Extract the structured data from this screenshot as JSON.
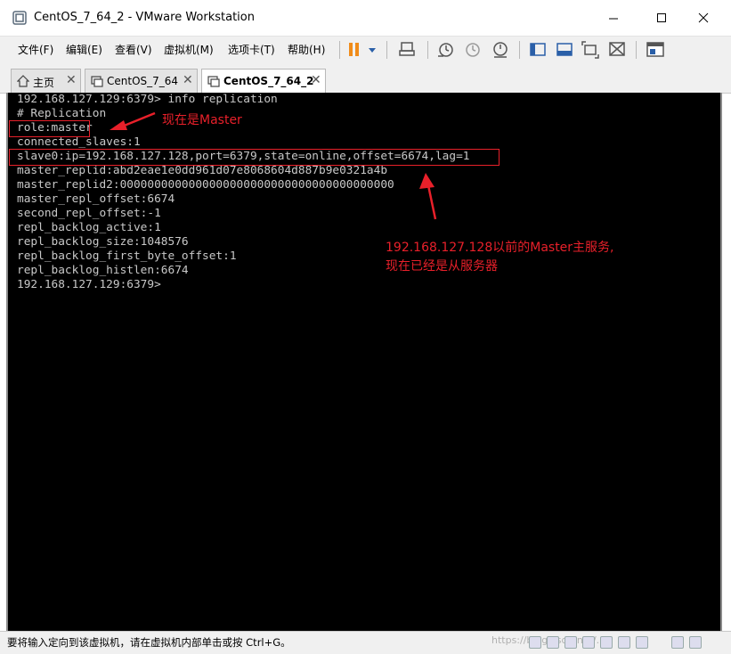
{
  "window": {
    "title": "CentOS_7_64_2 - VMware Workstation"
  },
  "menu": {
    "items": [
      "文件(F)",
      "编辑(E)",
      "查看(V)",
      "虚拟机(M)",
      "选项卡(T)",
      "帮助(H)"
    ]
  },
  "toolbar": {
    "icons": [
      "pause-icon",
      "dropdown-arrow-icon",
      "send-ctrl-alt-del-icon",
      "snapshot-take-icon",
      "snapshot-revert-icon",
      "snapshot-manager-icon",
      "view-sidebar-icon",
      "view-console-icon",
      "fullscreen-icon",
      "unity-icon",
      "library-icon"
    ]
  },
  "tabs": [
    {
      "label": "主页",
      "icon": "home-icon"
    },
    {
      "label": "CentOS_7_64",
      "icon": "vm-icon"
    },
    {
      "label": "CentOS_7_64_2",
      "icon": "vm-icon",
      "active": true
    }
  ],
  "console": {
    "lines": [
      "192.168.127.129:6379> info replication",
      "# Replication",
      "role:master",
      "connected_slaves:1",
      "slave0:ip=192.168.127.128,port=6379,state=online,offset=6674,lag=1",
      "master_replid:abd2eae1e0dd961d07e8068604d887b9e0321a4b",
      "master_replid2:0000000000000000000000000000000000000000",
      "master_repl_offset:6674",
      "second_repl_offset:-1",
      "repl_backlog_active:1",
      "repl_backlog_size:1048576",
      "repl_backlog_first_byte_offset:1",
      "repl_backlog_histlen:6674",
      "192.168.127.129:6379>"
    ]
  },
  "annotations": {
    "master_note": "现在是Master",
    "slave_note_line1": "192.168.127.128以前的Master主服务,",
    "slave_note_line2": "现在已经是从服务器"
  },
  "status": {
    "text": "要将输入定向到该虚拟机，请在虚拟机内部单击或按 Ctrl+G。",
    "watermark": "https://blog.csdn.net/..."
  },
  "colors": {
    "annotation": "#e8202a",
    "console_bg": "#000000",
    "console_text": "#c8c8c8",
    "pause_orange": "#f08c1a"
  }
}
